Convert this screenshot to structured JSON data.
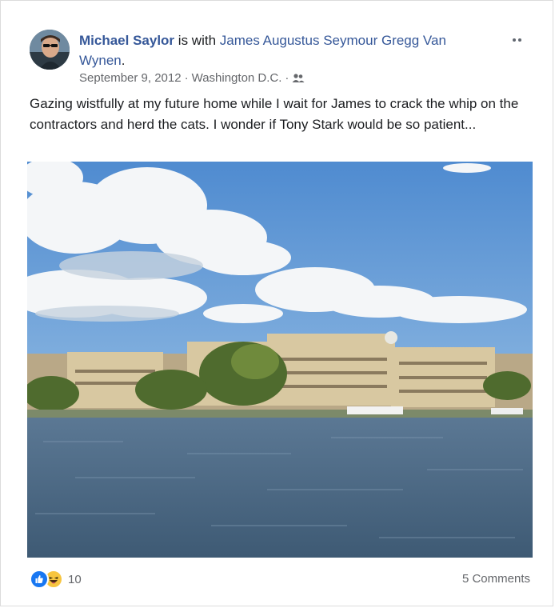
{
  "post": {
    "author": "Michael Saylor",
    "with_text": " is with ",
    "tagged": "James Augustus Seymour Gregg Van Wynen",
    "tagged_suffix": ".",
    "date": "September 9, 2012",
    "location": "Washington D.C.",
    "meta_sep": "·",
    "audience_icon": "friends-icon",
    "body": "Gazing wistfully at my future home while I wait for James to crack the whip on the contractors and herd the cats. I wonder if Tony Stark would be so patient...",
    "photo_icon": "waterfront-photo"
  },
  "footer": {
    "reaction_icons": [
      "like-icon",
      "haha-icon"
    ],
    "reaction_count": "10",
    "comments": "5 Comments"
  },
  "colors": {
    "link": "#365899",
    "meta": "#65676b",
    "like": "#1877f2",
    "haha": "#f7c53f",
    "sky": "#5f97d2",
    "water": "#4d6a84"
  }
}
